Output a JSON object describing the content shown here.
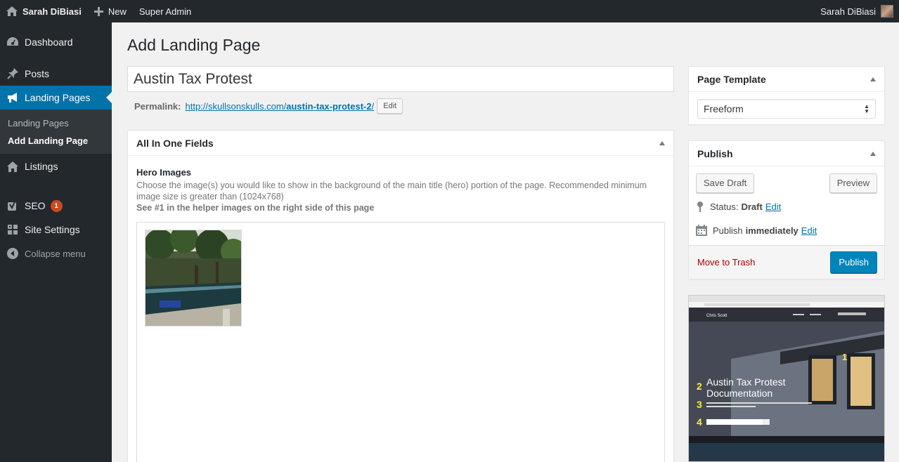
{
  "adminbar": {
    "site_name": "Sarah DiBiasi",
    "new_label": "New",
    "super_admin": "Super Admin",
    "user_name": "Sarah DiBiasi"
  },
  "sidebar": {
    "dashboard": "Dashboard",
    "posts": "Posts",
    "landing_pages": "Landing Pages",
    "sub_landing_pages": "Landing Pages",
    "sub_add_landing_page": "Add Landing Page",
    "listings": "Listings",
    "seo": "SEO",
    "seo_badge": "1",
    "site_settings": "Site Settings",
    "collapse": "Collapse menu"
  },
  "main": {
    "page_title": "Add Landing Page",
    "title_value": "Austin Tax Protest",
    "permalink_label": "Permalink:",
    "permalink_base": "http://skullsonskulls.com/",
    "permalink_slug": "austin-tax-protest-2",
    "permalink_trailing": "/",
    "permalink_edit": "Edit"
  },
  "aiof": {
    "title": "All In One Fields",
    "field_label": "Hero Images",
    "field_desc": "Choose the image(s) you would like to show in the background of the main title (hero) portion of the page. Recommended minimum image size is greater than (1024x768)",
    "field_help": "See #1 in the helper images on the right side of this page"
  },
  "template_box": {
    "title": "Page Template",
    "selected": "Freeform"
  },
  "publish_box": {
    "title": "Publish",
    "save_draft": "Save Draft",
    "preview": "Preview",
    "status_label": "Status:",
    "status_value": "Draft",
    "status_edit": "Edit",
    "publish_label": "Publish",
    "publish_value": "immediately",
    "publish_edit": "Edit",
    "move_to_trash": "Move to Trash",
    "publish_button": "Publish"
  },
  "helper": {
    "site_name": "Chris Scott",
    "headline_line1": "Austin Tax Protest",
    "headline_line2": "Documentation",
    "marker1": "1",
    "marker2": "2",
    "marker3": "3",
    "marker4": "4"
  },
  "colors": {
    "accent": "#0073aa",
    "primary_button": "#0085ba",
    "sidebar_bg": "#23282d",
    "trash_red": "#aa0000",
    "badge": "#ca4a1f"
  }
}
